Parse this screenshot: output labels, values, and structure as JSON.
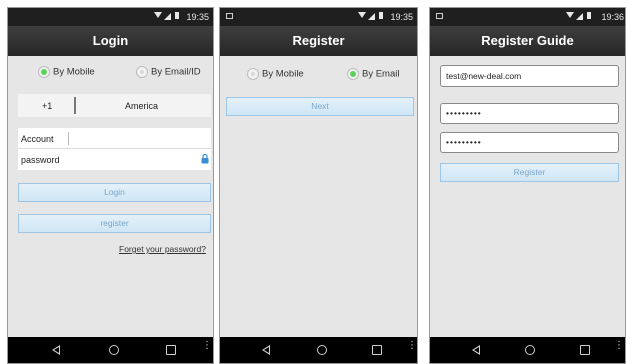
{
  "status": {
    "time_1": "19:35",
    "time_2": "19:35",
    "time_3": "19:36"
  },
  "login": {
    "title": "Login",
    "radio_mobile": "By Mobile",
    "radio_email": "By Email/ID",
    "country_code": "+1",
    "country_name": "America",
    "account_placeholder": "Account",
    "password_placeholder": "password",
    "login_button": "Login",
    "register_button": "register",
    "forgot_link": "Forget your password?"
  },
  "register": {
    "title": "Register",
    "radio_mobile": "By Mobile",
    "radio_email": "By Email",
    "next_button": "Next"
  },
  "guide": {
    "title": "Register Guide",
    "email_value": "test@new-deal.com",
    "password_value": "•••••••••",
    "confirm_value": "•••••••••",
    "register_button": "Register"
  },
  "nav": {
    "more": "⋮"
  },
  "colors": {
    "radio_on": "#5bd15b",
    "button_text": "#7aa6c8",
    "lock_icon": "#3a8fd8"
  },
  "icons": [
    "wifi-icon",
    "signal-icon",
    "battery-icon",
    "image-notification-icon",
    "lock-icon",
    "back-icon",
    "home-icon",
    "recents-icon",
    "more-icon"
  ]
}
